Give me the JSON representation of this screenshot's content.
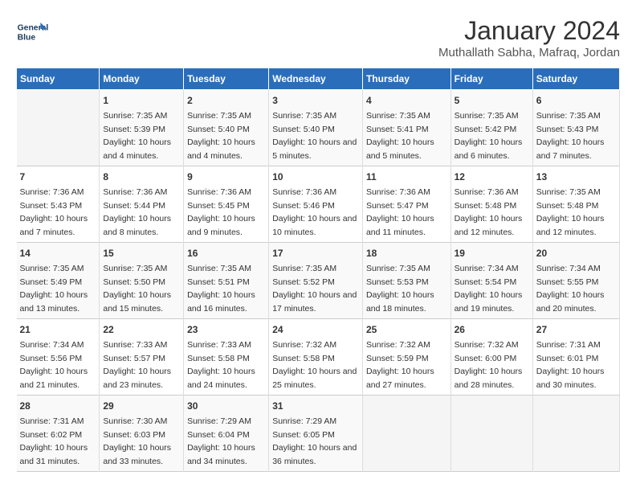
{
  "logo": {
    "line1": "General",
    "line2": "Blue"
  },
  "title": "January 2024",
  "location": "Muthallath Sabha, Mafraq, Jordan",
  "days_of_week": [
    "Sunday",
    "Monday",
    "Tuesday",
    "Wednesday",
    "Thursday",
    "Friday",
    "Saturday"
  ],
  "weeks": [
    [
      {
        "day": "",
        "sunrise": "",
        "sunset": "",
        "daylight": ""
      },
      {
        "day": "1",
        "sunrise": "Sunrise: 7:35 AM",
        "sunset": "Sunset: 5:39 PM",
        "daylight": "Daylight: 10 hours and 4 minutes."
      },
      {
        "day": "2",
        "sunrise": "Sunrise: 7:35 AM",
        "sunset": "Sunset: 5:40 PM",
        "daylight": "Daylight: 10 hours and 4 minutes."
      },
      {
        "day": "3",
        "sunrise": "Sunrise: 7:35 AM",
        "sunset": "Sunset: 5:40 PM",
        "daylight": "Daylight: 10 hours and 5 minutes."
      },
      {
        "day": "4",
        "sunrise": "Sunrise: 7:35 AM",
        "sunset": "Sunset: 5:41 PM",
        "daylight": "Daylight: 10 hours and 5 minutes."
      },
      {
        "day": "5",
        "sunrise": "Sunrise: 7:35 AM",
        "sunset": "Sunset: 5:42 PM",
        "daylight": "Daylight: 10 hours and 6 minutes."
      },
      {
        "day": "6",
        "sunrise": "Sunrise: 7:35 AM",
        "sunset": "Sunset: 5:43 PM",
        "daylight": "Daylight: 10 hours and 7 minutes."
      }
    ],
    [
      {
        "day": "7",
        "sunrise": "Sunrise: 7:36 AM",
        "sunset": "Sunset: 5:43 PM",
        "daylight": "Daylight: 10 hours and 7 minutes."
      },
      {
        "day": "8",
        "sunrise": "Sunrise: 7:36 AM",
        "sunset": "Sunset: 5:44 PM",
        "daylight": "Daylight: 10 hours and 8 minutes."
      },
      {
        "day": "9",
        "sunrise": "Sunrise: 7:36 AM",
        "sunset": "Sunset: 5:45 PM",
        "daylight": "Daylight: 10 hours and 9 minutes."
      },
      {
        "day": "10",
        "sunrise": "Sunrise: 7:36 AM",
        "sunset": "Sunset: 5:46 PM",
        "daylight": "Daylight: 10 hours and 10 minutes."
      },
      {
        "day": "11",
        "sunrise": "Sunrise: 7:36 AM",
        "sunset": "Sunset: 5:47 PM",
        "daylight": "Daylight: 10 hours and 11 minutes."
      },
      {
        "day": "12",
        "sunrise": "Sunrise: 7:36 AM",
        "sunset": "Sunset: 5:48 PM",
        "daylight": "Daylight: 10 hours and 12 minutes."
      },
      {
        "day": "13",
        "sunrise": "Sunrise: 7:35 AM",
        "sunset": "Sunset: 5:48 PM",
        "daylight": "Daylight: 10 hours and 12 minutes."
      }
    ],
    [
      {
        "day": "14",
        "sunrise": "Sunrise: 7:35 AM",
        "sunset": "Sunset: 5:49 PM",
        "daylight": "Daylight: 10 hours and 13 minutes."
      },
      {
        "day": "15",
        "sunrise": "Sunrise: 7:35 AM",
        "sunset": "Sunset: 5:50 PM",
        "daylight": "Daylight: 10 hours and 15 minutes."
      },
      {
        "day": "16",
        "sunrise": "Sunrise: 7:35 AM",
        "sunset": "Sunset: 5:51 PM",
        "daylight": "Daylight: 10 hours and 16 minutes."
      },
      {
        "day": "17",
        "sunrise": "Sunrise: 7:35 AM",
        "sunset": "Sunset: 5:52 PM",
        "daylight": "Daylight: 10 hours and 17 minutes."
      },
      {
        "day": "18",
        "sunrise": "Sunrise: 7:35 AM",
        "sunset": "Sunset: 5:53 PM",
        "daylight": "Daylight: 10 hours and 18 minutes."
      },
      {
        "day": "19",
        "sunrise": "Sunrise: 7:34 AM",
        "sunset": "Sunset: 5:54 PM",
        "daylight": "Daylight: 10 hours and 19 minutes."
      },
      {
        "day": "20",
        "sunrise": "Sunrise: 7:34 AM",
        "sunset": "Sunset: 5:55 PM",
        "daylight": "Daylight: 10 hours and 20 minutes."
      }
    ],
    [
      {
        "day": "21",
        "sunrise": "Sunrise: 7:34 AM",
        "sunset": "Sunset: 5:56 PM",
        "daylight": "Daylight: 10 hours and 21 minutes."
      },
      {
        "day": "22",
        "sunrise": "Sunrise: 7:33 AM",
        "sunset": "Sunset: 5:57 PM",
        "daylight": "Daylight: 10 hours and 23 minutes."
      },
      {
        "day": "23",
        "sunrise": "Sunrise: 7:33 AM",
        "sunset": "Sunset: 5:58 PM",
        "daylight": "Daylight: 10 hours and 24 minutes."
      },
      {
        "day": "24",
        "sunrise": "Sunrise: 7:32 AM",
        "sunset": "Sunset: 5:58 PM",
        "daylight": "Daylight: 10 hours and 25 minutes."
      },
      {
        "day": "25",
        "sunrise": "Sunrise: 7:32 AM",
        "sunset": "Sunset: 5:59 PM",
        "daylight": "Daylight: 10 hours and 27 minutes."
      },
      {
        "day": "26",
        "sunrise": "Sunrise: 7:32 AM",
        "sunset": "Sunset: 6:00 PM",
        "daylight": "Daylight: 10 hours and 28 minutes."
      },
      {
        "day": "27",
        "sunrise": "Sunrise: 7:31 AM",
        "sunset": "Sunset: 6:01 PM",
        "daylight": "Daylight: 10 hours and 30 minutes."
      }
    ],
    [
      {
        "day": "28",
        "sunrise": "Sunrise: 7:31 AM",
        "sunset": "Sunset: 6:02 PM",
        "daylight": "Daylight: 10 hours and 31 minutes."
      },
      {
        "day": "29",
        "sunrise": "Sunrise: 7:30 AM",
        "sunset": "Sunset: 6:03 PM",
        "daylight": "Daylight: 10 hours and 33 minutes."
      },
      {
        "day": "30",
        "sunrise": "Sunrise: 7:29 AM",
        "sunset": "Sunset: 6:04 PM",
        "daylight": "Daylight: 10 hours and 34 minutes."
      },
      {
        "day": "31",
        "sunrise": "Sunrise: 7:29 AM",
        "sunset": "Sunset: 6:05 PM",
        "daylight": "Daylight: 10 hours and 36 minutes."
      },
      {
        "day": "",
        "sunrise": "",
        "sunset": "",
        "daylight": ""
      },
      {
        "day": "",
        "sunrise": "",
        "sunset": "",
        "daylight": ""
      },
      {
        "day": "",
        "sunrise": "",
        "sunset": "",
        "daylight": ""
      }
    ]
  ]
}
